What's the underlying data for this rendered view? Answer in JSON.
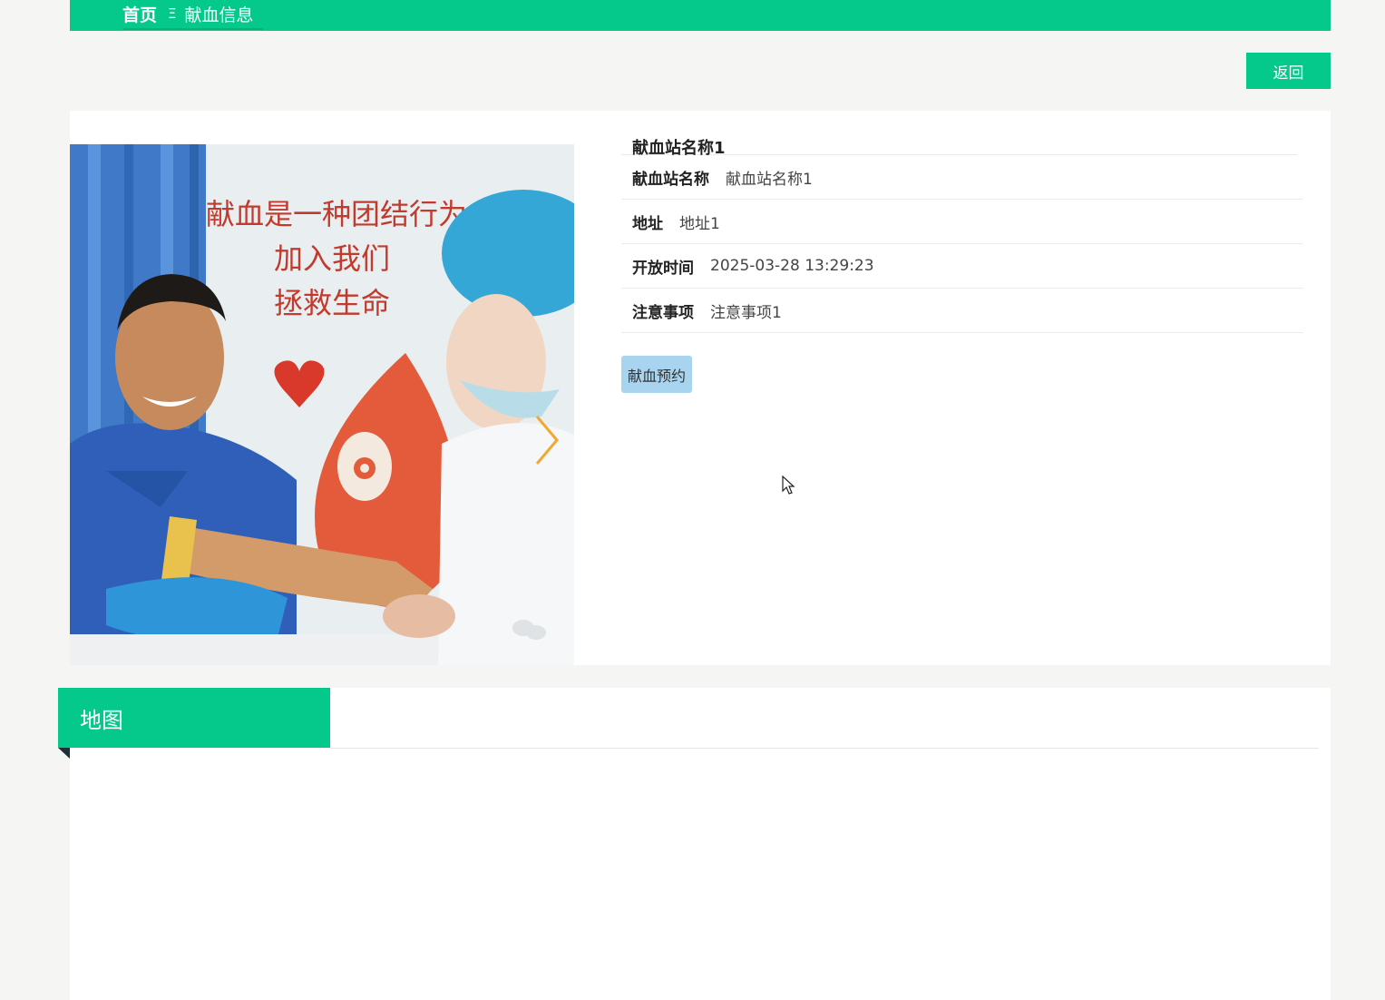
{
  "breadcrumb": {
    "home": "首页",
    "separator": "Ξ",
    "current": "献血信息"
  },
  "toolbar": {
    "back_label": "返回"
  },
  "detail": {
    "title": "献血站名称1",
    "fields": [
      {
        "label": "献血站名称",
        "value": "献血站名称1"
      },
      {
        "label": "地址",
        "value": "地址1"
      },
      {
        "label": "开放时间",
        "value": "2025-03-28 13:29:23"
      },
      {
        "label": "注意事项",
        "value": "注意事项1"
      }
    ],
    "reserve_label": "献血预约"
  },
  "photo": {
    "poster_lines": [
      "献血是一种团结行为",
      "加入我们",
      "拯救生命"
    ]
  },
  "map": {
    "title": "地图"
  },
  "colors": {
    "accent": "#05c98a",
    "reserve_button": "#a8d4ef"
  }
}
